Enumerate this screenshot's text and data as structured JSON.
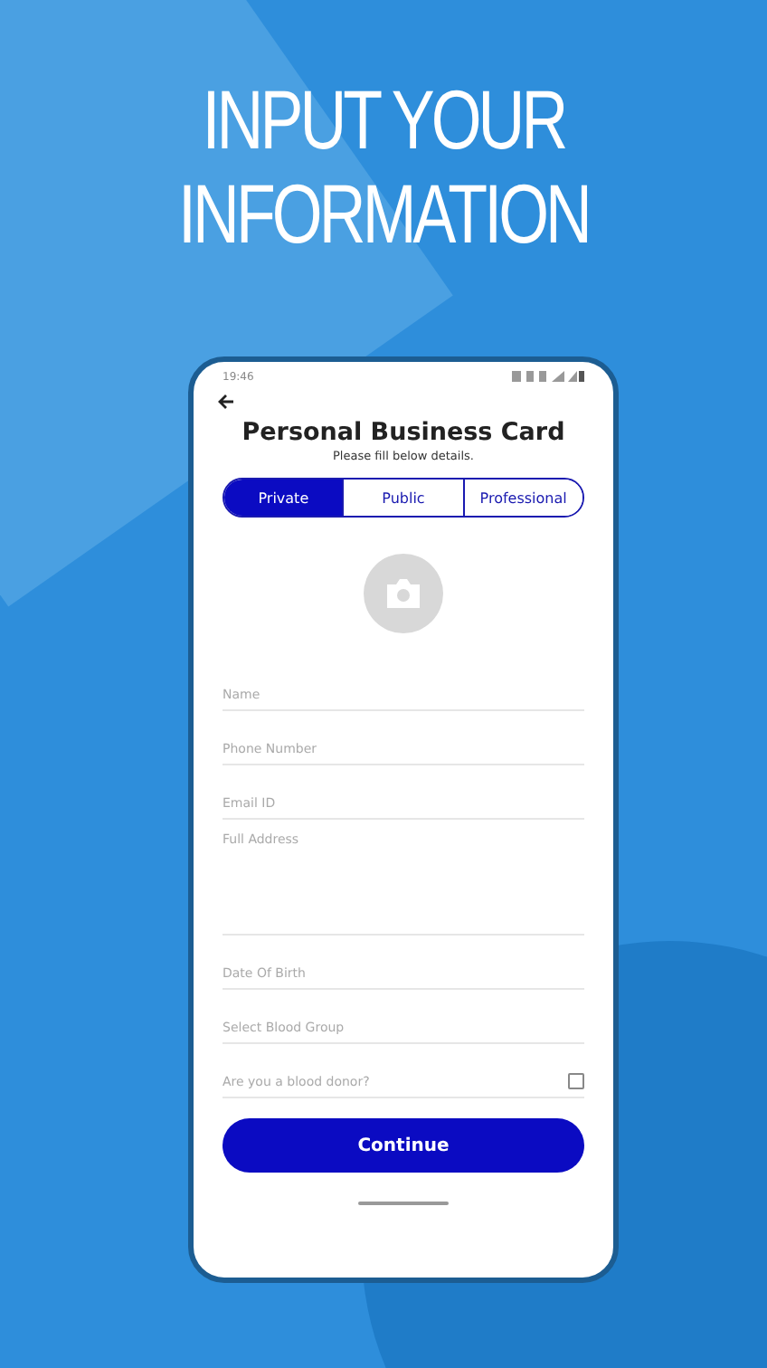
{
  "headline": [
    "INPUT YOUR",
    "INFORMATION"
  ],
  "phone": {
    "status_bar": {
      "time": "19:46"
    },
    "title": "Personal Business Card",
    "subtitle": "Please fill below details.",
    "tabs": [
      {
        "label": "Private",
        "selected": true
      },
      {
        "label": "Public",
        "selected": false
      },
      {
        "label": "Professional",
        "selected": false
      }
    ],
    "fields": [
      {
        "kind": "text",
        "placeholder": "Name"
      },
      {
        "kind": "text",
        "placeholder": "Phone Number"
      },
      {
        "kind": "text",
        "placeholder": "Email ID"
      },
      {
        "kind": "multiline",
        "placeholder": "Full Address"
      },
      {
        "kind": "text",
        "placeholder": "Date Of Birth"
      },
      {
        "kind": "text",
        "placeholder": "Select Blood Group"
      },
      {
        "kind": "checkbox",
        "label": "Are you a blood donor?",
        "checked": false
      }
    ],
    "button": "Continue"
  }
}
